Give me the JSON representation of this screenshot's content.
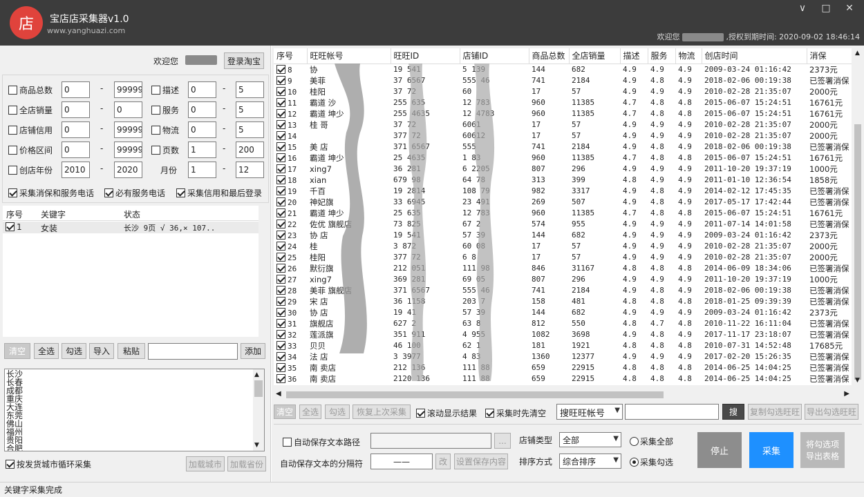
{
  "app": {
    "logo_char": "店",
    "title": "宝店店采集器v1.0",
    "url": "www.yanghuazi.com"
  },
  "window": {
    "min": "∨",
    "max": "□",
    "close": "✕"
  },
  "top_status": {
    "welcome": "欢迎您",
    "auth": ",授权到期时间: 2020-09-02 18:46:14"
  },
  "login": {
    "welcome": "欢迎您",
    "button": "登录淘宝"
  },
  "filters": [
    {
      "label": "商品总数",
      "min": "0",
      "max": "99999"
    },
    {
      "label": "全店销量",
      "min": "0",
      "max": "0"
    },
    {
      "label": "店铺信用",
      "min": "0",
      "max": "99999"
    },
    {
      "label": "价格区间",
      "min": "0",
      "max": "99999"
    },
    {
      "label": "创店年份",
      "min": "2010",
      "max": "2020"
    }
  ],
  "filters_right": [
    {
      "label": "描述",
      "min": "0",
      "max": "5",
      "checkbox": true
    },
    {
      "label": "服务",
      "min": "0",
      "max": "5",
      "checkbox": true
    },
    {
      "label": "物流",
      "min": "0",
      "max": "5",
      "checkbox": true
    },
    {
      "label": "页数",
      "min": "1",
      "max": "200",
      "checkbox": true
    },
    {
      "label": "月份",
      "min": "1",
      "max": "12",
      "checkbox": false
    }
  ],
  "dash": "-",
  "options": {
    "opt1": "采集消保和服务电话",
    "opt2": "必有服务电话",
    "opt3": "采集信用和最后登录"
  },
  "kw_table": {
    "headers": [
      "序号",
      "关键字",
      "状态"
    ],
    "row": {
      "no": "1",
      "keyword": "女装",
      "status": "长沙 9页 √ 36,× 107.."
    }
  },
  "kw_buttons": {
    "clear": "清空",
    "select_all": "全选",
    "check": "勾选",
    "import": "导入",
    "paste": "粘贴",
    "add": "添加"
  },
  "cities": [
    "长沙",
    "长春",
    "成都",
    "重庆",
    "大连",
    "东莞",
    "佛山",
    "福州",
    "贵阳",
    "合肥"
  ],
  "city_options": {
    "loop": "按发货城市循环采集",
    "load_city": "加载城市",
    "load_province": "加载省份"
  },
  "grid": {
    "headers": [
      "序号",
      "旺旺帐号",
      "旺旺ID",
      "店铺ID",
      "商品总数",
      "全店销量",
      "描述",
      "服务",
      "物流",
      "创店时间",
      "消保"
    ],
    "rows": [
      [
        "8",
        "协",
        "19 541",
        "5 139",
        "144",
        "682",
        "4.9",
        "4.9",
        "4.9",
        "2009-03-24 01:16:42",
        "2373元"
      ],
      [
        "9",
        "美菲",
        "37 6567",
        "555 46",
        "741",
        "2184",
        "4.9",
        "4.8",
        "4.9",
        "2018-02-06 00:19:38",
        "已签署消保"
      ],
      [
        "10",
        "桂阳",
        "37 72",
        "60",
        "17",
        "57",
        "4.9",
        "4.9",
        "4.9",
        "2010-02-28 21:35:07",
        "2000元"
      ],
      [
        "11",
        "霸道 沙",
        "255 635",
        "12 783",
        "960",
        "11385",
        "4.7",
        "4.8",
        "4.8",
        "2015-06-07 15:24:51",
        "16761元"
      ],
      [
        "12",
        "霸道 坤少",
        "255 4635",
        "12 4783",
        "960",
        "11385",
        "4.7",
        "4.8",
        "4.8",
        "2015-06-07 15:24:51",
        "16761元"
      ],
      [
        "13",
        "桂 哥",
        "37 72",
        "6061",
        "17",
        "57",
        "4.9",
        "4.9",
        "4.9",
        "2010-02-28 21:35:07",
        "2000元"
      ],
      [
        "14",
        "",
        "377 72",
        "60612",
        "17",
        "57",
        "4.9",
        "4.9",
        "4.9",
        "2010-02-28 21:35:07",
        "2000元"
      ],
      [
        "15",
        "美 店",
        "371 6567",
        "555",
        "741",
        "2184",
        "4.9",
        "4.8",
        "4.9",
        "2018-02-06 00:19:38",
        "已签署消保"
      ],
      [
        "16",
        "霸道 坤少",
        "25 4635",
        "1 83",
        "960",
        "11385",
        "4.7",
        "4.8",
        "4.8",
        "2015-06-07 15:24:51",
        "16761元"
      ],
      [
        "17",
        "xing7",
        "36 281",
        "6 2205",
        "807",
        "296",
        "4.9",
        "4.9",
        "4.9",
        "2011-10-20 19:37:19",
        "1000元"
      ],
      [
        "18",
        "xian",
        "679 98",
        "64 78",
        "313",
        "399",
        "4.8",
        "4.9",
        "4.9",
        "2011-01-10 12:36:54",
        "1858元"
      ],
      [
        "19",
        "千百",
        "19 2814",
        "108 79",
        "982",
        "3317",
        "4.9",
        "4.8",
        "4.9",
        "2014-02-12 17:45:35",
        "已签署消保"
      ],
      [
        "20",
        "神妃旗",
        "33 6945",
        "23 491",
        "269",
        "507",
        "4.9",
        "4.8",
        "4.9",
        "2017-05-17 17:42:44",
        "已签署消保"
      ],
      [
        "21",
        "霸道 坤少",
        "25 635",
        "12 783",
        "960",
        "11385",
        "4.7",
        "4.8",
        "4.8",
        "2015-06-07 15:24:51",
        "16761元"
      ],
      [
        "22",
        "佐优 旗舰店",
        "73 825",
        "67 2",
        "574",
        "955",
        "4.9",
        "4.9",
        "4.9",
        "2011-07-14 14:01:58",
        "已签署消保"
      ],
      [
        "23",
        "协 店",
        "19 541",
        "57 39",
        "144",
        "682",
        "4.9",
        "4.9",
        "4.9",
        "2009-03-24 01:16:42",
        "2373元"
      ],
      [
        "24",
        "桂",
        "3 872",
        "60 08",
        "17",
        "57",
        "4.9",
        "4.9",
        "4.9",
        "2010-02-28 21:35:07",
        "2000元"
      ],
      [
        "25",
        "桂阳",
        "377 72",
        "6 8",
        "17",
        "57",
        "4.9",
        "4.9",
        "4.9",
        "2010-02-28 21:35:07",
        "2000元"
      ],
      [
        "26",
        "默衍旗",
        "212 051",
        "111 98",
        "846",
        "31167",
        "4.8",
        "4.8",
        "4.8",
        "2014-06-09 18:34:06",
        "已签署消保"
      ],
      [
        "27",
        "xing7",
        "369 281",
        "69 05",
        "807",
        "296",
        "4.9",
        "4.9",
        "4.9",
        "2011-10-20 19:37:19",
        "1000元"
      ],
      [
        "28",
        "美菲 旗舰店",
        "371 6567",
        "555 46",
        "741",
        "2184",
        "4.9",
        "4.8",
        "4.9",
        "2018-02-06 00:19:38",
        "已签署消保"
      ],
      [
        "29",
        "宋 店",
        "36 1158",
        "203 7",
        "158",
        "481",
        "4.8",
        "4.8",
        "4.8",
        "2018-01-25 09:39:39",
        "已签署消保"
      ],
      [
        "30",
        "协 店",
        "19 41",
        "57 39",
        "144",
        "682",
        "4.9",
        "4.9",
        "4.9",
        "2009-03-24 01:16:42",
        "2373元"
      ],
      [
        "31",
        "旗舰店",
        "627 2",
        "63 8",
        "812",
        "550",
        "4.8",
        "4.7",
        "4.8",
        "2010-11-22 16:11:04",
        "已签署消保"
      ],
      [
        "32",
        "莲派旗",
        "351 911",
        "4 955",
        "1082",
        "3698",
        "4.9",
        "4.8",
        "4.9",
        "2017-11-17 23:18:07",
        "已签署消保"
      ],
      [
        "33",
        "贝贝",
        "46 100",
        "62 1",
        "181",
        "1921",
        "4.8",
        "4.8",
        "4.8",
        "2010-07-31 14:52:48",
        "17685元"
      ],
      [
        "34",
        "法 店",
        "3 3977",
        "4 83",
        "1360",
        "12377",
        "4.9",
        "4.9",
        "4.9",
        "2017-02-20 15:26:35",
        "已签署消保"
      ],
      [
        "35",
        "南 卖店",
        "212 136",
        "111 88",
        "659",
        "22915",
        "4.8",
        "4.8",
        "4.8",
        "2014-06-25 14:04:25",
        "已签署消保"
      ],
      [
        "36",
        "南 卖店",
        "2120 136",
        "111 88",
        "659",
        "22915",
        "4.8",
        "4.8",
        "4.8",
        "2014-06-25 14:04:25",
        "已签署消保"
      ]
    ]
  },
  "grid_toolbar": {
    "clear": "清空",
    "select_all": "全选",
    "check": "勾选",
    "restore": "恢复上次采集",
    "scroll": "滚动显示结果",
    "clear_first": "采集时先清空",
    "search_type": "搜旺旺帐号",
    "search_btn": "搜",
    "copy": "复制勾选旺旺",
    "export": "导出勾选旺旺"
  },
  "bottom": {
    "autosave": "自动保存文本路径",
    "browse": "...",
    "separator_label": "自动保存文本的分隔符",
    "separator_value": "——",
    "change": "改",
    "set_content": "设置保存内容",
    "shop_type_label": "店铺类型",
    "shop_type_value": "全部",
    "sort_label": "排序方式",
    "sort_value": "综合排序",
    "collect_all": "采集全部",
    "collect_checked": "采集勾选",
    "stop": "停止",
    "collect": "采集",
    "export_table": "将勾选项导出表格"
  },
  "status": "关键字采集完成",
  "colors": {
    "titlebar": "#3c3c3c",
    "logo": "#e0433c",
    "stop": "#8d8d8d",
    "collect": "#1e90ff",
    "export": "#b9b9b9"
  }
}
